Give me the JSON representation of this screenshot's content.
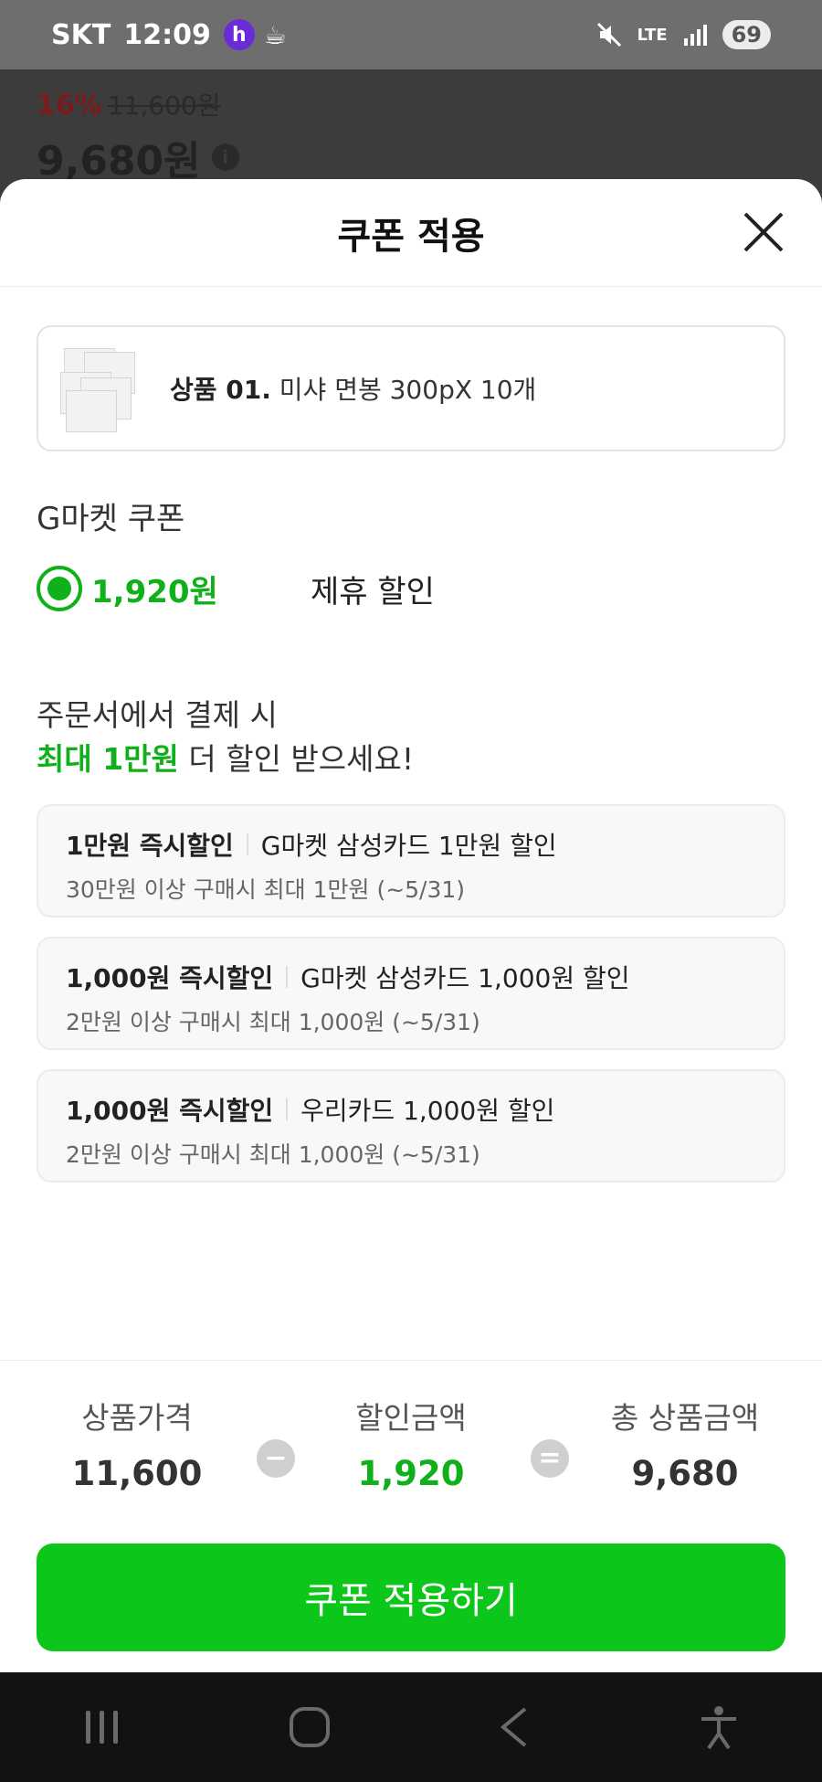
{
  "status_bar": {
    "carrier": "SKT",
    "time": "12:09",
    "battery": "69",
    "network": "LTE"
  },
  "background_page": {
    "discount_rate": "16%",
    "original_price": "11,600원",
    "price": "9,680원"
  },
  "sheet": {
    "title": "쿠폰 적용"
  },
  "product": {
    "number": "상품 01.",
    "name": "미샤 면봉 300pX 10개"
  },
  "coupon_section": {
    "label": "G마켓 쿠폰",
    "selected_amount": "1,920원",
    "selected_desc": "제휴 할인"
  },
  "promo": {
    "line1": "주문서에서 결제 시",
    "highlight": "최대 1만원",
    "line2_rest": " 더 할인 받으세요!"
  },
  "card_offers": [
    {
      "title": "1만원 즉시할인",
      "name": "G마켓 삼성카드 1만원 할인",
      "condition": "30만원 이상 구매시 최대 1만원 (~5/31)"
    },
    {
      "title": "1,000원 즉시할인",
      "name": "G마켓 삼성카드 1,000원 할인",
      "condition": "2만원 이상 구매시 최대 1,000원 (~5/31)"
    },
    {
      "title": "1,000원 즉시할인",
      "name": "우리카드 1,000원 할인",
      "condition": "2만원 이상 구매시 최대 1,000원 (~5/31)"
    }
  ],
  "summary": {
    "price_label": "상품가격",
    "price_value": "11,600",
    "minus": "−",
    "discount_label": "할인금액",
    "discount_value": "1,920",
    "equals": "=",
    "total_label": "총 상품금액",
    "total_value": "9,680"
  },
  "apply_button": "쿠폰 적용하기",
  "colors": {
    "accent_green": "#0fb019",
    "button_green": "#0cc619"
  }
}
